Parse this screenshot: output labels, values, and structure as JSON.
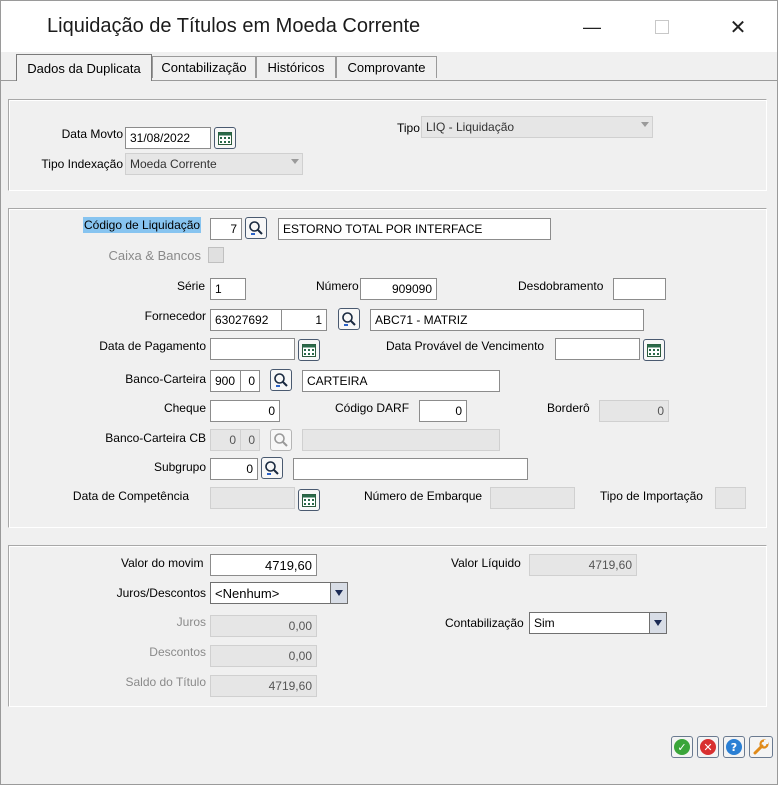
{
  "window": {
    "title": "Liquidação de Títulos em Moeda Corrente",
    "minimize_glyph": "—",
    "close_glyph": "✕"
  },
  "tabs": [
    {
      "label": "Dados da Duplicata",
      "active": true
    },
    {
      "label": "Contabilização",
      "active": false
    },
    {
      "label": "Históricos",
      "active": false
    },
    {
      "label": "Comprovante",
      "active": false
    }
  ],
  "header": {
    "data_movto_label": "Data Movto",
    "data_movto_value": "31/08/2022",
    "tipo_label": "Tipo",
    "tipo_value": "LIQ - Liquidação",
    "tipo_indexacao_label": "Tipo Indexação",
    "tipo_indexacao_value": "Moeda Corrente"
  },
  "details": {
    "codigo_liquidacao_label": "Código de Liquidação",
    "codigo_liquidacao_value": "7",
    "codigo_liquidacao_desc": "ESTORNO TOTAL POR INTERFACE",
    "caixa_bancos_label": "Caixa & Bancos",
    "serie_label": "Série",
    "serie_value": "1",
    "numero_label": "Número",
    "numero_value": "909090",
    "desdobramento_label": "Desdobramento",
    "desdobramento_value": "",
    "fornecedor_label": "Fornecedor",
    "fornecedor_code": "63027692",
    "fornecedor_loja": "1",
    "fornecedor_name": "ABC71 - MATRIZ",
    "data_pagamento_label": "Data de Pagamento",
    "data_pagamento_value": "",
    "data_provavel_label": "Data Provável de Vencimento",
    "data_provavel_value": "",
    "banco_carteira_label": "Banco-Carteira",
    "banco_value": "900",
    "carteira_value": "0",
    "banco_carteira_desc": "CARTEIRA",
    "cheque_label": "Cheque",
    "cheque_value": "0",
    "codigo_darf_label": "Código DARF",
    "codigo_darf_value": "0",
    "bordero_label": "Borderô",
    "bordero_value": "0",
    "banco_carteira_cb_label": "Banco-Carteira CB",
    "banco_cb_value": "0",
    "carteira_cb_value": "0",
    "banco_carteira_cb_desc": "",
    "subgrupo_label": "Subgrupo",
    "subgrupo_value": "0",
    "subgrupo_desc": "",
    "data_competencia_label": "Data de Competência",
    "data_competencia_value": "",
    "numero_embarque_label": "Número de Embarque",
    "numero_embarque_value": "",
    "tipo_importacao_label": "Tipo de Importação",
    "tipo_importacao_value": ""
  },
  "values": {
    "valor_movimento_label": "Valor do movim",
    "valor_movimento_value": "4719,60",
    "valor_liquido_label": "Valor Líquido",
    "valor_liquido_value": "4719,60",
    "juros_descontos_label": "Juros/Descontos",
    "juros_descontos_value": "<Nenhum>",
    "juros_label": "Juros",
    "juros_value": "0,00",
    "contabilizacao_label": "Contabilização",
    "contabilizacao_value": "Sim",
    "descontos_label": "Descontos",
    "descontos_value": "0,00",
    "saldo_titulo_label": "Saldo do Título",
    "saldo_titulo_value": "4719,60"
  },
  "actions": {
    "ok_glyph": "✓",
    "cancel_glyph": "✕",
    "help_glyph": "?"
  },
  "colors": {
    "ok": "#3aa53a",
    "cancel": "#d83030",
    "help": "#2a7fd4",
    "tools": "#e08a18",
    "highlight": "#87c4f0"
  }
}
